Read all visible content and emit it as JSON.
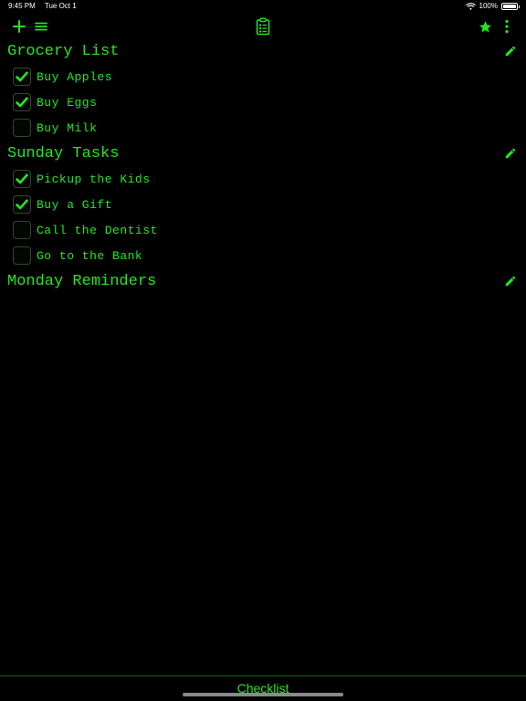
{
  "status": {
    "time": "9:45 PM",
    "date": "Tue Oct 1",
    "battery": "100%",
    "battery_level": 1.0
  },
  "toolbar": {
    "icons": [
      "plus-icon",
      "menu-icon",
      "clipboard-list-icon",
      "star-icon",
      "more-vertical-icon"
    ]
  },
  "colors": {
    "accent": "#22e622",
    "background": "#000000",
    "checkbox_border": "#2f4a2f"
  },
  "lists": [
    {
      "title": "Grocery List",
      "items": [
        {
          "label": "Buy Apples",
          "checked": true
        },
        {
          "label": "Buy Eggs",
          "checked": true
        },
        {
          "label": "Buy Milk",
          "checked": false
        }
      ]
    },
    {
      "title": "Sunday Tasks",
      "items": [
        {
          "label": "Pickup the Kids",
          "checked": true
        },
        {
          "label": "Buy a Gift",
          "checked": true
        },
        {
          "label": "Call the Dentist",
          "checked": false
        },
        {
          "label": "Go to the Bank",
          "checked": false
        }
      ]
    },
    {
      "title": "Monday Reminders",
      "items": []
    }
  ],
  "bottom_bar": {
    "title": "Checklist"
  }
}
